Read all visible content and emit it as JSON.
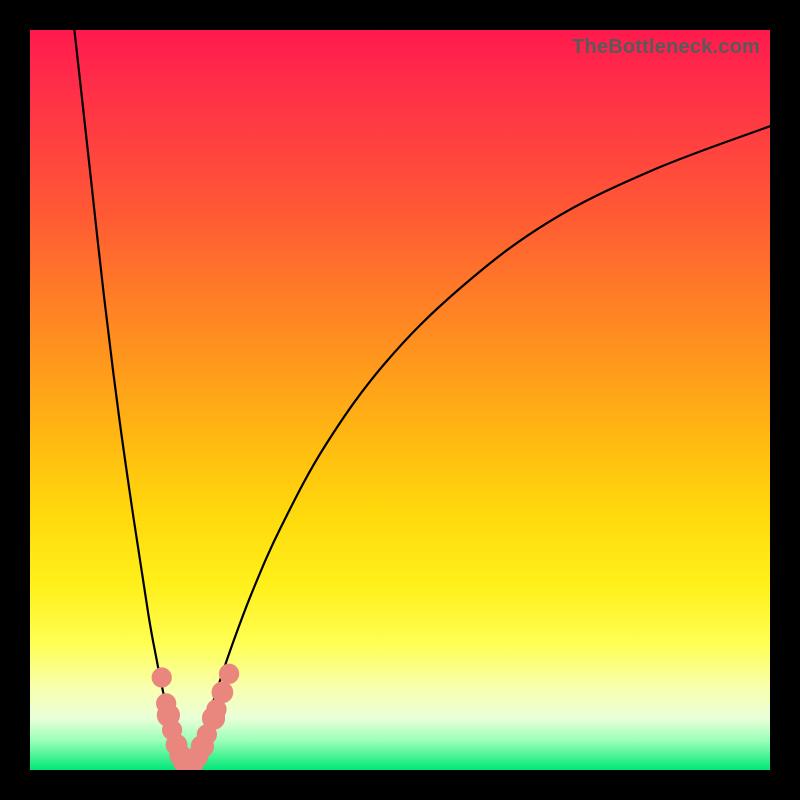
{
  "watermark": "TheBottleneck.com",
  "chart_data": {
    "type": "line",
    "title": "",
    "xlabel": "",
    "ylabel": "",
    "xlim": [
      0,
      100
    ],
    "ylim": [
      0,
      100
    ],
    "grid": false,
    "legend": false,
    "series": [
      {
        "name": "left-curve",
        "x": [
          6,
          8,
          10,
          12,
          14,
          16,
          17,
          18,
          19,
          19.5,
          20,
          20.5,
          21
        ],
        "y": [
          100,
          82,
          64,
          48,
          34,
          21,
          15.5,
          10.5,
          6.5,
          4.5,
          3,
          1.5,
          0.5
        ]
      },
      {
        "name": "right-curve",
        "x": [
          21.5,
          22,
          23,
          24,
          25,
          27,
          30,
          34,
          40,
          48,
          58,
          70,
          84,
          100
        ],
        "y": [
          0.5,
          1.5,
          4,
          7,
          10,
          16,
          24,
          33,
          44,
          55,
          65,
          74,
          81,
          87
        ]
      }
    ],
    "markers": {
      "name": "highlighted-points",
      "points": [
        {
          "x": 17.8,
          "y": 12.5,
          "r": 1.3
        },
        {
          "x": 18.4,
          "y": 9.0,
          "r": 1.3
        },
        {
          "x": 18.7,
          "y": 7.4,
          "r": 1.5
        },
        {
          "x": 19.2,
          "y": 5.4,
          "r": 1.3
        },
        {
          "x": 19.8,
          "y": 3.4,
          "r": 1.4
        },
        {
          "x": 20.3,
          "y": 2.0,
          "r": 1.4
        },
        {
          "x": 20.8,
          "y": 1.0,
          "r": 1.4
        },
        {
          "x": 21.4,
          "y": 0.6,
          "r": 1.4
        },
        {
          "x": 22.0,
          "y": 0.9,
          "r": 1.4
        },
        {
          "x": 22.6,
          "y": 1.8,
          "r": 1.4
        },
        {
          "x": 23.3,
          "y": 3.2,
          "r": 1.5
        },
        {
          "x": 23.9,
          "y": 4.8,
          "r": 1.3
        },
        {
          "x": 24.8,
          "y": 7.0,
          "r": 1.5
        },
        {
          "x": 25.2,
          "y": 8.2,
          "r": 1.3
        },
        {
          "x": 26.0,
          "y": 10.5,
          "r": 1.4
        },
        {
          "x": 26.9,
          "y": 13.0,
          "r": 1.3
        }
      ]
    },
    "background_gradient": {
      "top": "#ff1a4d",
      "mid": "#ffd000",
      "bottom": "#00e878"
    }
  }
}
